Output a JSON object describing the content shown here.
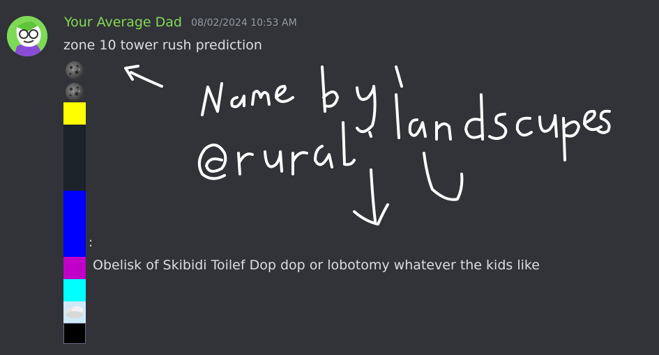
{
  "message": {
    "author": "Your Average Dad",
    "author_color": "#84d957",
    "timestamp": "08/02/2024 10:53 AM",
    "text": "zone 10 tower rush prediction",
    "separator": ":",
    "continuation": "Obelisk of Skibidi Toilef Dop dop or lobotomy whatever the kids like"
  },
  "emoji_stack": [
    {
      "name": "moon-emoji"
    },
    {
      "name": "moon-emoji"
    },
    {
      "name": "yellow-square",
      "color": "#ffff00"
    },
    {
      "name": "dark-square",
      "color": "#1c222a"
    },
    {
      "name": "blue-square",
      "color": "#0000ff"
    },
    {
      "name": "magenta-square",
      "color": "#c000c8"
    },
    {
      "name": "cyan-square",
      "color": "#00ffff"
    },
    {
      "name": "cloud-emoji"
    },
    {
      "name": "black-square",
      "color": "#000000"
    }
  ],
  "annotation": {
    "line1": "Name by",
    "line2": "@rural.landscapes",
    "color": "#ffffff"
  }
}
